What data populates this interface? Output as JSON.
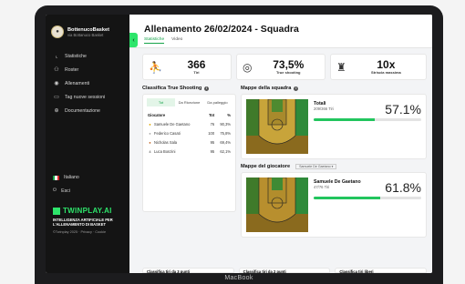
{
  "laptop_label": "MacBook",
  "sidebar": {
    "brand_name": "BottenucoBasket",
    "brand_sub": "via Bottanuco Basket",
    "items": [
      {
        "label": "Statistiche",
        "icon": "chart-icon"
      },
      {
        "label": "Roster",
        "icon": "users-icon"
      },
      {
        "label": "Allenamenti",
        "icon": "whistle-icon"
      },
      {
        "label": "Tag nuove sessioni",
        "icon": "tag-icon"
      },
      {
        "label": "Documentazione",
        "icon": "document-icon"
      }
    ],
    "language": "Italiano",
    "logout": "Esci",
    "logo_text": "TWINPLAY.AI",
    "tagline": "INTELLIGENZA ARTIFICIALE PER L'ALLENAMENTO DI BASKET",
    "copyright": "©Twinplay 2025 · Privacy · Cookie"
  },
  "header": {
    "title": "Allenamento 26/02/2024 - Squadra",
    "tabs": [
      "Statistiche",
      "Video"
    ]
  },
  "stats": [
    {
      "value": "366",
      "label": "Tiri",
      "icon": "basketball-hoop-icon"
    },
    {
      "value": "73,5%",
      "label": "True shooting",
      "icon": "target-icon"
    },
    {
      "value": "10x",
      "label": "Striscia massima",
      "icon": "trophy-icon"
    }
  ],
  "classifica": {
    "title": "Classifica True Shooting",
    "filters": [
      "Tot",
      "Da Ricezione",
      "Da palleggio"
    ],
    "headers": [
      "Giocatore",
      "Tot",
      "%"
    ],
    "rows": [
      {
        "medal": "gold",
        "name": "Samuele De Gaetano",
        "tot": "76",
        "pct": "90,3%"
      },
      {
        "medal": "silver",
        "name": "Federico Casati",
        "tot": "100",
        "pct": "75,8%"
      },
      {
        "medal": "bronze",
        "name": "Nicholas Sala",
        "tot": "95",
        "pct": "69,4%"
      },
      {
        "medal": "4",
        "name": "Luca Bonzini",
        "tot": "95",
        "pct": "62,1%"
      }
    ]
  },
  "mappe_squadra": {
    "title": "Mappe della squadra",
    "name": "Totali",
    "sub": "209/366 Tiri",
    "pct": "57.1%",
    "fill": 0.571
  },
  "mappe_giocatore": {
    "title": "Mappe del giocatore",
    "select": "Samuele De Gaetano",
    "name": "Samuele De Gaetano",
    "sub": "47/76 Tiri",
    "pct": "61.8%",
    "fill": 0.618
  },
  "bottom_cards": [
    "Classifica tiri da 3 punti",
    "Classifica tiri da 2 punti",
    "Classifica tiri liberi"
  ],
  "colors": {
    "accent": "#2ee56b",
    "sidebar": "#141414"
  }
}
